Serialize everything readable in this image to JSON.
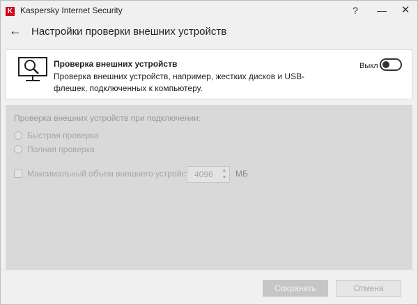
{
  "window": {
    "app_title": "Kaspersky Internet Security",
    "logo_letter": "K",
    "help_glyph": "?",
    "minimize_glyph": "—",
    "close_glyph": "✕"
  },
  "header": {
    "back_glyph": "←",
    "title": "Настройки проверки внешних устройств"
  },
  "feature_card": {
    "icon": "monitor-magnifier-icon",
    "title": "Проверка внешних устройств",
    "description": "Проверка внешних устройств, например, жестких дисков и USB-флешек, подключенных к компьютеру.",
    "toggle_label": "Выкл",
    "toggle_on": false
  },
  "settings": {
    "heading": "Проверка внешних устройств при подключении:",
    "options": [
      {
        "label": "Быстрая проверка",
        "selected": false
      },
      {
        "label": "Полная проверка",
        "selected": false
      }
    ],
    "max_size": {
      "label": "Максимальный объем внешнего устройства:",
      "checked": false,
      "value": "4096",
      "unit": "МБ"
    },
    "enabled": false
  },
  "footer": {
    "save_label": "Сохранить",
    "cancel_label": "Отмена"
  },
  "colors": {
    "brand": "#d0021b",
    "disabled_panel": "#d9d9d9",
    "card_bg": "#ffffff"
  }
}
